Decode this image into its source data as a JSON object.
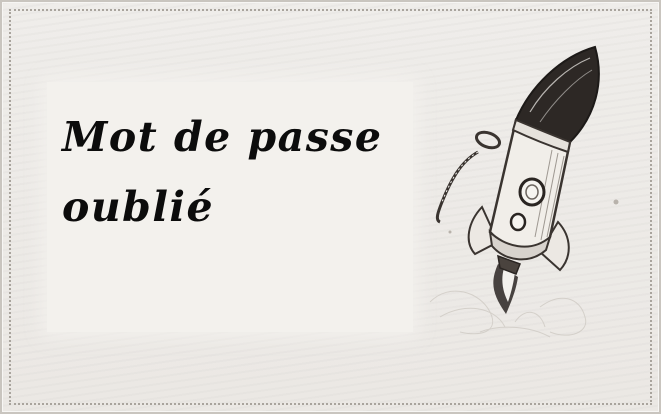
{
  "page": {
    "title": "Mot de passe oublié"
  },
  "colors": {
    "background": "#ebe8e4",
    "frame_dots": "#a9a49d",
    "title_text": "#0c0c0c"
  },
  "icons": {
    "illustration": "rocket-icon"
  }
}
